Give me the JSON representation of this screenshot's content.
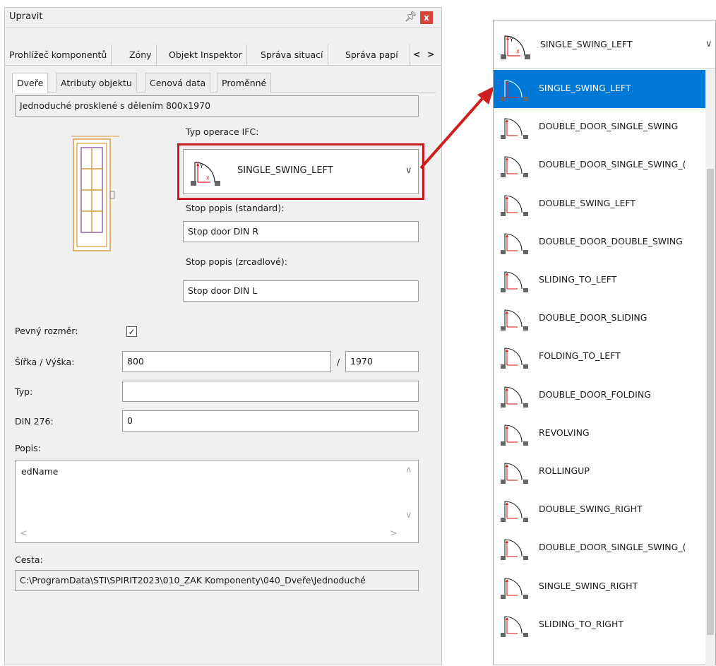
{
  "panel": {
    "title": "Upravit",
    "tabs_main": [
      "Prohlížeč komponentů",
      "Zóny",
      "Objekt Inspektor",
      "Správa situací",
      "Správa papí"
    ],
    "nav_prev": "<",
    "nav_next": ">",
    "tabs_sub": [
      "Dveře",
      "Atributy objektu",
      "Cenová data",
      "Proměnné"
    ],
    "name_value": "Jednoduché prosklené s dělením 800x1970",
    "ifc_label": "Typ operace IFC:",
    "ifc_value": "SINGLE_SWING_LEFT",
    "stop_std_label": "Stop popis (standard):",
    "stop_std_value": "Stop door DIN R",
    "stop_mirror_label": "Stop popis (zrcadlové):",
    "stop_mirror_value": "Stop door DIN L",
    "fixed_size_label": "Pevný rozměr:",
    "fixed_size_checked": true,
    "size_label": "Šířka / Výška:",
    "width_value": "800",
    "size_sep": "/",
    "height_value": "1970",
    "type_label": "Typ:",
    "type_value": "",
    "din_label": "DIN 276:",
    "din_value": "0",
    "desc_label": "Popis:",
    "desc_value": "edName",
    "path_label": "Cesta:",
    "path_value": "C:\\ProgramData\\STI\\SPIRIT2023\\010_ZAK Komponenty\\040_Dveře\\Jednoduché"
  },
  "dropdown": {
    "current": "SINGLE_SWING_LEFT",
    "items": [
      "SINGLE_SWING_LEFT",
      "DOUBLE_DOOR_SINGLE_SWING",
      "DOUBLE_DOOR_SINGLE_SWING_(",
      "DOUBLE_SWING_LEFT",
      "DOUBLE_DOOR_DOUBLE_SWING",
      "SLIDING_TO_LEFT",
      "DOUBLE_DOOR_SLIDING",
      "FOLDING_TO_LEFT",
      "DOUBLE_DOOR_FOLDING",
      "REVOLVING",
      "ROLLINGUP",
      "DOUBLE_SWING_RIGHT",
      "DOUBLE_DOOR_SINGLE_SWING_(",
      "SINGLE_SWING_RIGHT",
      "SLIDING_TO_RIGHT"
    ],
    "selected_index": 0
  },
  "colors": {
    "accent": "#0078d7",
    "highlight": "#c8191e",
    "door_frame": "#d89a3c",
    "door_glass": "#8a5aa8"
  },
  "icons": {
    "door_operation_icon": "door-operation-icon",
    "arrow": "red-arrow"
  }
}
